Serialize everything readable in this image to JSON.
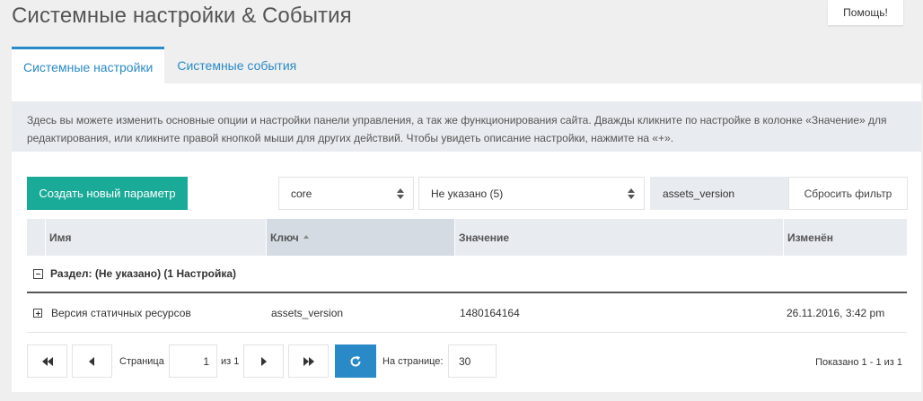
{
  "page": {
    "title": "Системные настройки & События",
    "help_label": "Помощь!"
  },
  "tabs": [
    {
      "label": "Системные настройки",
      "active": true
    },
    {
      "label": "Системные события",
      "active": false
    }
  ],
  "description": "Здесь вы можете изменить основные опции и настройки панели управления, а так же функционирования сайта. Дважды кликните по настройке в колонке «Значение» для редактирования, или кликните правой кнопкой мыши для других действий. Чтобы увидеть описание настройки, нажмите на «+».",
  "toolbar": {
    "create_label": "Создать новый параметр",
    "namespace_value": "core",
    "area_value": "Не указано (5)",
    "search_value": "assets_version",
    "reset_label": "Сбросить фильтр"
  },
  "grid": {
    "columns": {
      "name": "Имя",
      "key": "Ключ",
      "value": "Значение",
      "changed": "Изменён"
    },
    "sorted_column": "key",
    "group_label": "Раздел: (Не указано) (1 Настройка)",
    "rows": [
      {
        "name": "Версия статичных ресурсов",
        "key": "assets_version",
        "value": "1480164164",
        "changed": "26.11.2016, 3:42 pm"
      }
    ]
  },
  "pager": {
    "page_label": "Страница",
    "page_value": "1",
    "of_label": "из 1",
    "per_page_label": "На странице:",
    "per_page_value": "30",
    "shown_text": "Показано 1 - 1 из 1"
  },
  "colors": {
    "accent": "#2a8ac7",
    "create_button": "#1aaa98",
    "header_bg": "#e8ebef",
    "page_bg": "#efefef"
  },
  "icons": [
    "first-page-icon",
    "prev-page-icon",
    "next-page-icon",
    "last-page-icon",
    "refresh-icon",
    "select-arrows-icon",
    "collapse-icon",
    "expand-icon"
  ]
}
